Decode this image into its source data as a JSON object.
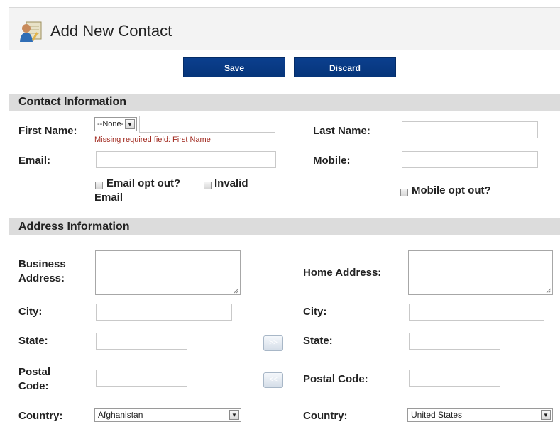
{
  "header": {
    "title": "Add New Contact",
    "icon": "contact-add-icon"
  },
  "toolbar": {
    "save_label": "Save",
    "discard_label": "Discard"
  },
  "contact_section": {
    "title": "Contact Information",
    "first_name_label": "First Name:",
    "salutation_value": "--None--",
    "first_name_error": "Missing required field: First Name",
    "last_name_label": "Last Name:",
    "email_label": "Email:",
    "mobile_label": "Mobile:",
    "email_opt_out_label": "Email opt out?",
    "invalid_email_label_1": "Invalid",
    "invalid_email_label_2": "Email",
    "mobile_opt_out_label": "Mobile opt out?"
  },
  "address_section": {
    "title": "Address Information",
    "business_address_label_1": "Business",
    "business_address_label_2": "Address:",
    "home_address_label": "Home Address:",
    "city_label": "City:",
    "state_label": "State:",
    "postal_label_1": "Postal",
    "postal_label_2": "Code:",
    "postal_code_label": "Postal Code:",
    "country_label": "Country:",
    "business_country": "Afghanistan",
    "home_country": "United States",
    "copy_right_glyph": ">>",
    "copy_left_glyph": "<<"
  },
  "colors": {
    "button_blue": "#06357a",
    "section_gray": "#dcdcdc",
    "error_red": "#a0281e"
  }
}
